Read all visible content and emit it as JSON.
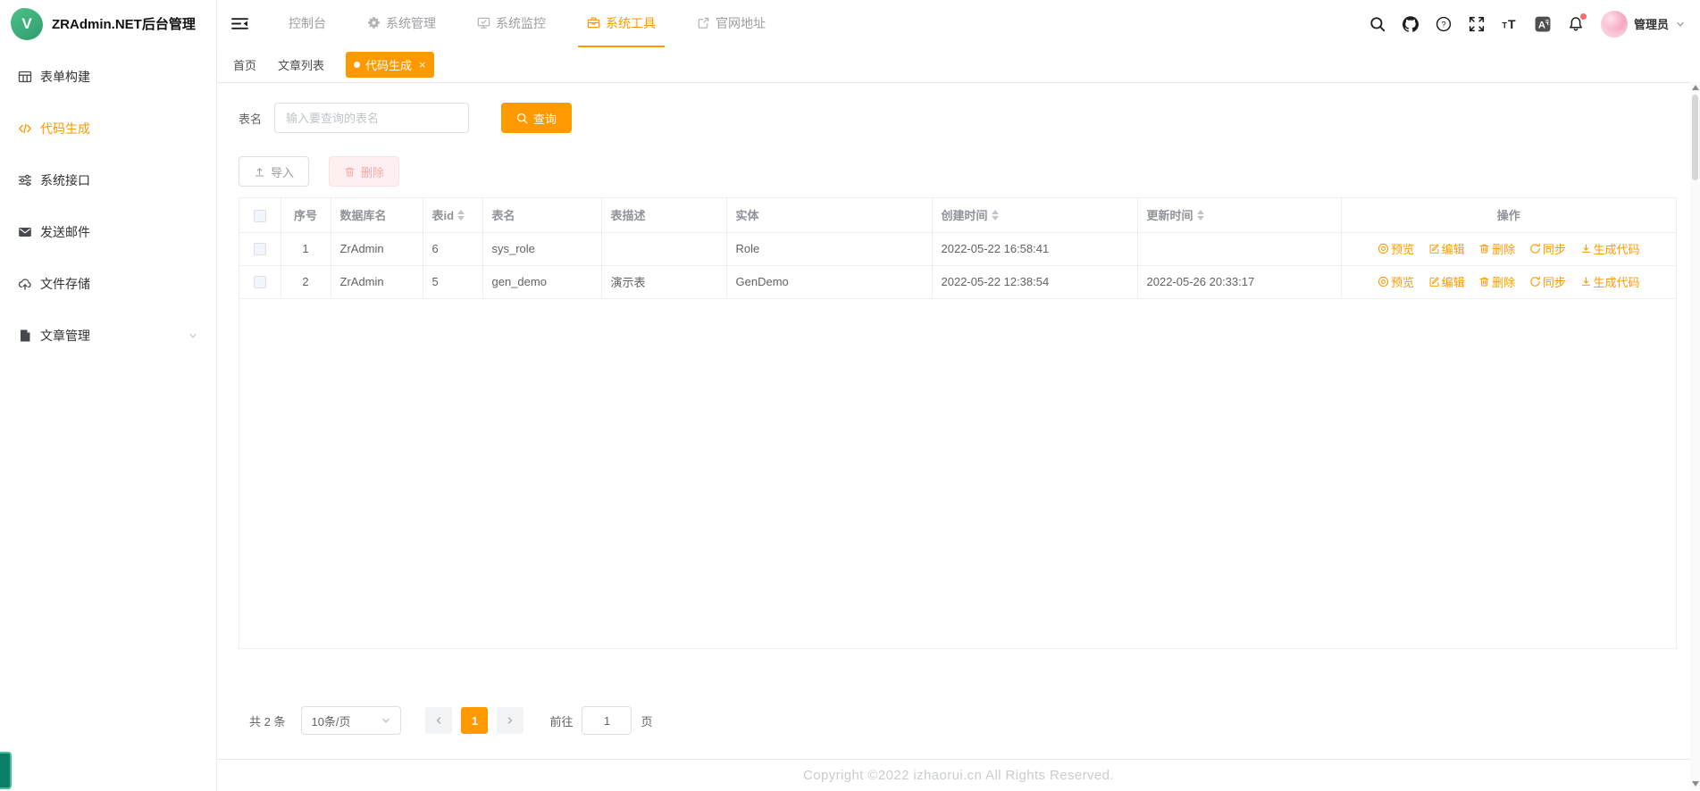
{
  "app": {
    "logo_letter": "V",
    "title": "ZRAdmin.NET后台管理"
  },
  "topnav": {
    "items": [
      {
        "label": "控制台",
        "icon": null,
        "active": false
      },
      {
        "label": "系统管理",
        "icon": "gear-icon",
        "active": false
      },
      {
        "label": "系统监控",
        "icon": "monitor-icon",
        "active": false
      },
      {
        "label": "系统工具",
        "icon": "toolbox-icon",
        "active": true
      },
      {
        "label": "官网地址",
        "icon": "external-link-icon",
        "active": false
      }
    ],
    "user": {
      "name": "管理员"
    }
  },
  "sidebar": {
    "items": [
      {
        "label": "表单构建",
        "icon": "grid-icon",
        "active": false
      },
      {
        "label": "代码生成",
        "icon": "code-icon",
        "active": true
      },
      {
        "label": "系统接口",
        "icon": "sliders-icon",
        "active": false
      },
      {
        "label": "发送邮件",
        "icon": "mail-icon",
        "active": false
      },
      {
        "label": "文件存储",
        "icon": "cloud-upload-icon",
        "active": false
      },
      {
        "label": "文章管理",
        "icon": "document-icon",
        "active": false,
        "expandable": true
      }
    ]
  },
  "tabs": {
    "items": [
      {
        "label": "首页",
        "active": false
      },
      {
        "label": "文章列表",
        "active": false
      },
      {
        "label": "代码生成",
        "active": true,
        "closable": true
      }
    ],
    "close_glyph": "×"
  },
  "filter": {
    "label": "表名",
    "placeholder": "输入要查询的表名",
    "search_button": "查询"
  },
  "toolbar": {
    "import_button": "导入",
    "delete_button": "删除"
  },
  "table": {
    "headers": {
      "index": "序号",
      "db_name": "数据库名",
      "table_id": "表id",
      "table_name": "表名",
      "table_desc": "表描述",
      "entity": "实体",
      "created": "创建时间",
      "updated": "更新时间",
      "actions": "操作"
    },
    "rows": [
      {
        "index": "1",
        "db_name": "ZrAdmin",
        "table_id": "6",
        "table_name": "sys_role",
        "table_desc": "",
        "entity": "Role",
        "created": "2022-05-22 16:58:41",
        "updated": ""
      },
      {
        "index": "2",
        "db_name": "ZrAdmin",
        "table_id": "5",
        "table_name": "gen_demo",
        "table_desc": "演示表",
        "entity": "GenDemo",
        "created": "2022-05-22 12:38:54",
        "updated": "2022-05-26 20:33:17"
      }
    ],
    "action_labels": [
      "预览",
      "编辑",
      "删除",
      "同步",
      "生成代码"
    ]
  },
  "pagination": {
    "total": "共 2 条",
    "page_size": "10条/页",
    "current_page": "1",
    "goto_label": "前往",
    "goto_value": "1",
    "page_unit": "页"
  },
  "footer": {
    "copyright": "Copyright ©2022 izhaorui.cn All Rights Reserved."
  },
  "colors": {
    "accent": "#ff9900",
    "danger_soft_bg": "#fef0f0",
    "danger_soft_text": "#f9a7a7",
    "badge_red": "#f56c6c",
    "logo_green": "#3eb37f"
  }
}
